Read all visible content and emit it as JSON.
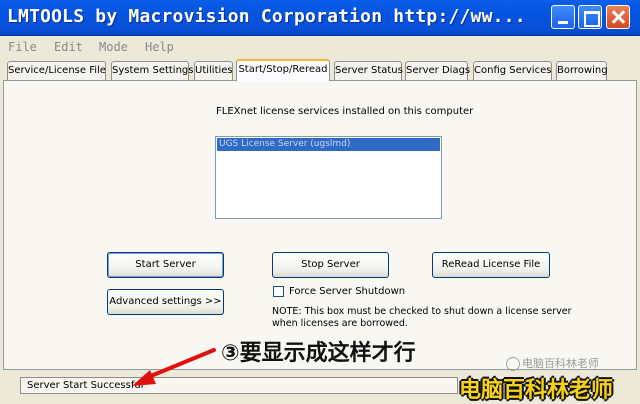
{
  "window": {
    "title": "LMTOOLS by Macrovision Corporation http://ww...",
    "controls": {
      "minimize": "minimize-icon",
      "maximize": "maximize-icon",
      "close": "close-icon"
    }
  },
  "menu": [
    "File",
    "Edit",
    "Mode",
    "Help"
  ],
  "tabs": [
    {
      "label": "Service/License File",
      "active": false
    },
    {
      "label": "System Settings",
      "active": false
    },
    {
      "label": "Utilities",
      "active": false
    },
    {
      "label": "Start/Stop/Reread",
      "active": true
    },
    {
      "label": "Server Status",
      "active": false
    },
    {
      "label": "Server Diags",
      "active": false
    },
    {
      "label": "Config Services",
      "active": false
    },
    {
      "label": "Borrowing",
      "active": false
    }
  ],
  "panel": {
    "services_label": "FLEXnet license services installed on this computer",
    "services": [
      "UGS License Server (ugslmd)"
    ],
    "buttons": {
      "start": "Start Server",
      "stop": "Stop Server",
      "reread": "ReRead License File",
      "advanced": "Advanced settings >>"
    },
    "force_shutdown": {
      "label": "Force Server Shutdown",
      "checked": false
    },
    "note": "NOTE:  This box must be checked to shut down a license server when licenses are borrowed."
  },
  "status": {
    "text": "Server Start Successful"
  },
  "overlay": {
    "annotation": "③要显示成这样才行",
    "watermark_small": "电脑百科林老师",
    "watermark_big": "电脑百科林老师",
    "accent_color": "#e01010",
    "watermark_color": "#f6d21c"
  }
}
